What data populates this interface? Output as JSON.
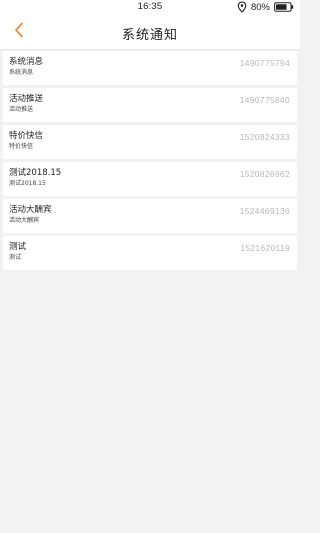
{
  "status_bar": {
    "time": "16:35",
    "battery": "80%"
  },
  "nav": {
    "title": "系统通知"
  },
  "colors": {
    "accent": "#f08a3c",
    "background": "#f2f2f2",
    "stamp": "#b8b8b8"
  },
  "icons": {
    "back": "chevron-left-icon",
    "location": "location-icon",
    "battery": "battery-icon"
  },
  "notifications": [
    {
      "title": "系统消息",
      "subtitle": "系统消息",
      "stamp": "1490775794"
    },
    {
      "title": "活动推送",
      "subtitle": "活动推送",
      "stamp": "1490775840"
    },
    {
      "title": "特价快信",
      "subtitle": "特价快信",
      "stamp": "1520824333"
    },
    {
      "title": "测试2018.15",
      "subtitle": "测试2018.15",
      "stamp": "1520826962"
    },
    {
      "title": "活动大酬宾",
      "subtitle": "活动大酬宾",
      "stamp": "1524469136"
    },
    {
      "title": "测试",
      "subtitle": "测试",
      "stamp": "1521620119"
    }
  ]
}
